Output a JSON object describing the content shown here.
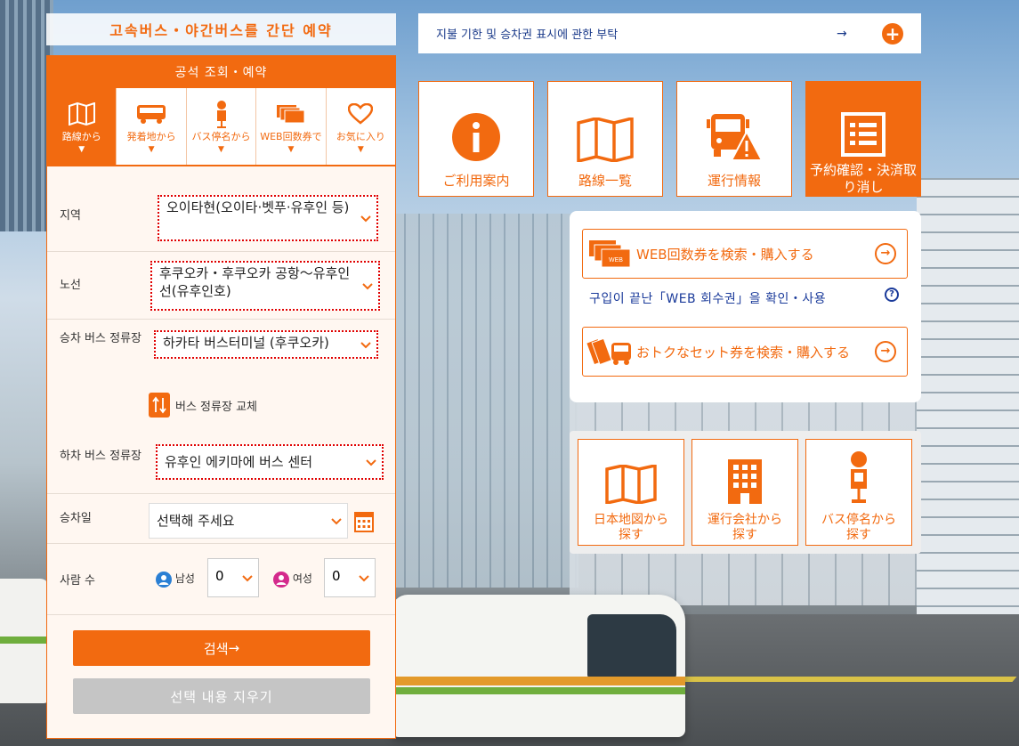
{
  "colors": {
    "accent": "#f26a10",
    "link": "#1a3a8a",
    "error_dotted": "#e00000",
    "disabled": "#c5c5c5"
  },
  "banner": {
    "title": "고속버스・야간버스를 간단 예약"
  },
  "notice": {
    "text": "지불 기한 및 승차권 표시에 관한 부탁",
    "arrow": "→",
    "plus": "+"
  },
  "panel": {
    "title": "공석 조회・예약",
    "tabs": [
      {
        "label": "路線から",
        "icon": "map-icon",
        "active": true
      },
      {
        "label": "発着地から",
        "icon": "bus-icon",
        "active": false
      },
      {
        "label": "バス停名から",
        "icon": "bus-stop-icon",
        "active": false
      },
      {
        "label": "WEB回数券で",
        "icon": "ticket-icon",
        "active": false
      },
      {
        "label": "お気に入り",
        "icon": "heart-icon",
        "active": false
      }
    ],
    "tab_marker": "▼",
    "region": {
      "label": "지역",
      "value": "오이타현(오이타·벳푸·유후인 등)"
    },
    "route": {
      "label": "노선",
      "value": "후쿠오카・후쿠오카 공항～유후인선(유후인호)"
    },
    "board_stop": {
      "label": "승차 버스 정류장",
      "value": "하카타 버스터미널 (후쿠오카)"
    },
    "swap": {
      "label": "버스 정류장 교체",
      "icon": "swap-icon"
    },
    "alight_stop": {
      "label": "하차 버스 정류장",
      "value": "유후인 에키마에 버스 센터"
    },
    "date": {
      "label": "승차일",
      "value": "선택해 주세요"
    },
    "people": {
      "label": "사람 수",
      "male_label": "남성",
      "male_value": "0",
      "female_label": "여성",
      "female_value": "0"
    },
    "search_label": "검색",
    "search_arrow": "→",
    "clear_label": "선택 내용 지우기"
  },
  "tiles": [
    {
      "label": "ご利用案内",
      "icon": "info-icon",
      "active": false
    },
    {
      "label": "路線一覧",
      "icon": "map-icon",
      "active": false
    },
    {
      "label": "運行情報",
      "icon": "bus-warning-icon",
      "active": false
    },
    {
      "label": "予約確認・決済取り消し",
      "icon": "list-icon",
      "active": true
    }
  ],
  "web": {
    "buy_label": "WEB回数券を検索・購入する",
    "link_label": "구입이 끝난「WEB 회수권」을 확인・사용",
    "set_label": "おトクなセット券を検索・購入する",
    "web_badge": "WEB",
    "help": "?"
  },
  "find": [
    {
      "label": "日本地図から探す",
      "icon": "map-icon"
    },
    {
      "label": "運行会社から探す",
      "icon": "building-icon"
    },
    {
      "label": "バス停名から探す",
      "icon": "bus-stop-icon"
    }
  ]
}
